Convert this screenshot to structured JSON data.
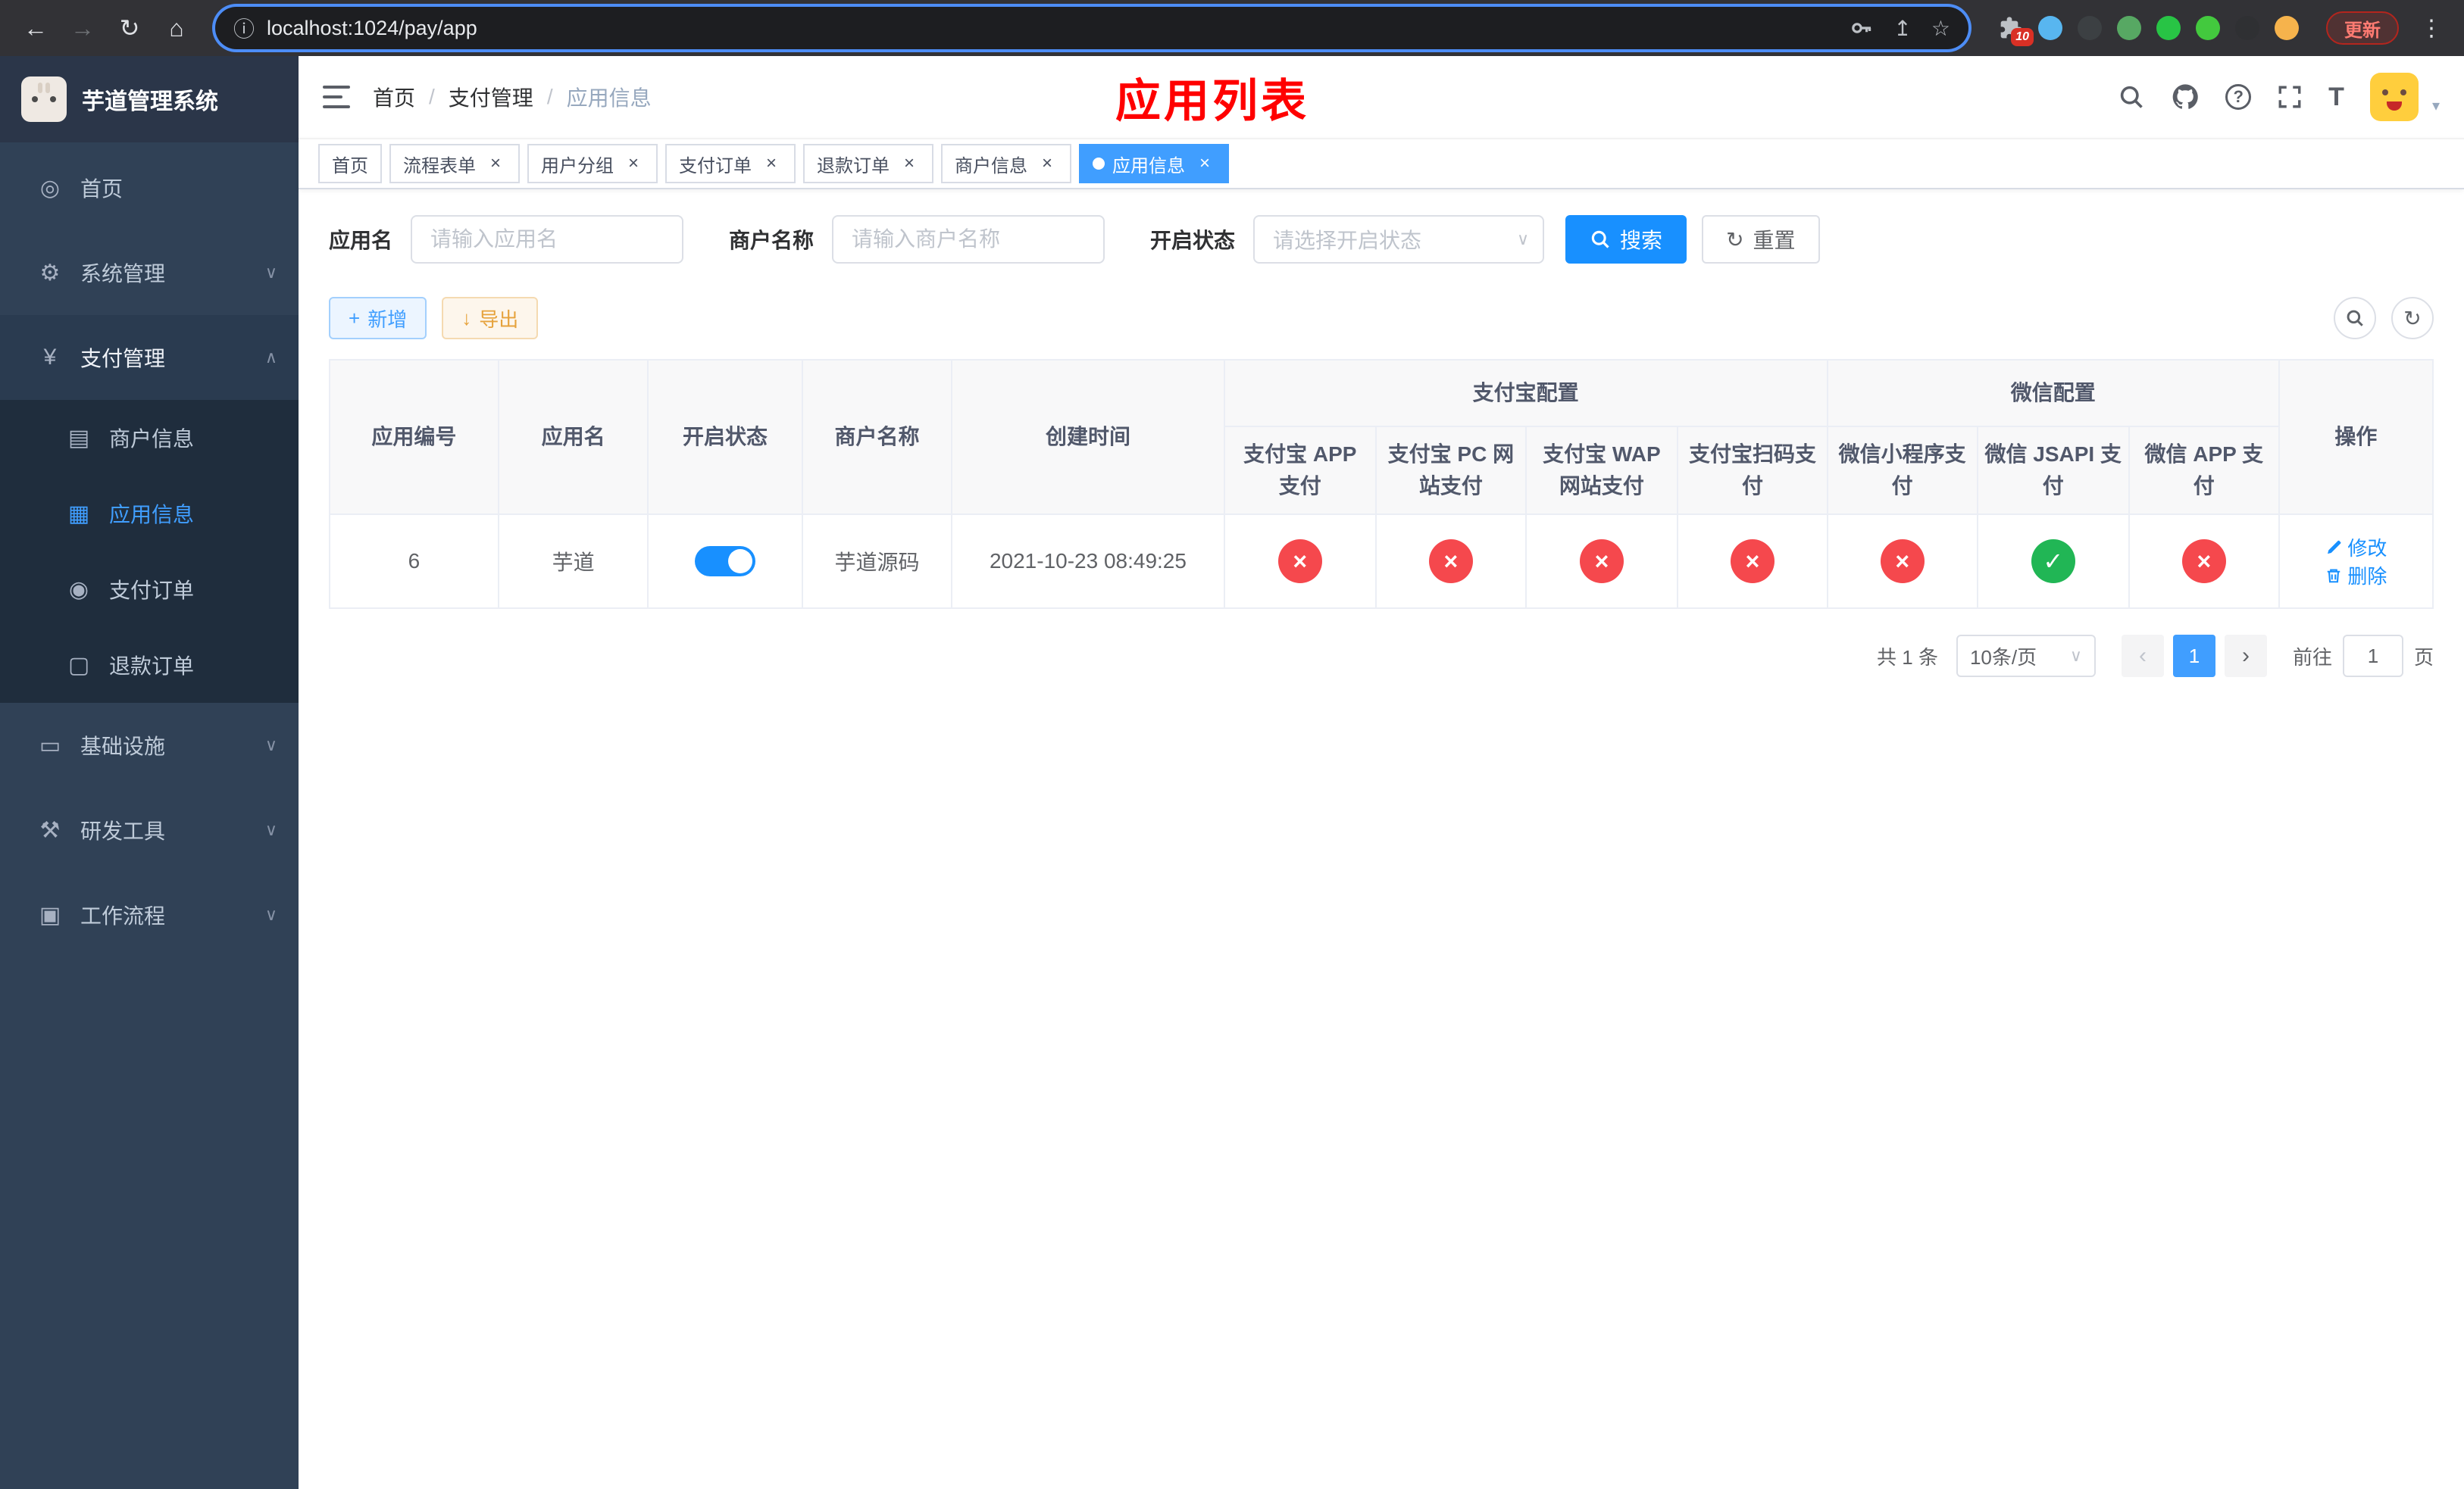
{
  "colors": {
    "accent": "#409eff",
    "primary": "#1890ff",
    "danger": "#f5484d",
    "success": "#21b655",
    "warning": "#e6a23c",
    "title-red": "#ff0000",
    "sidebar-bg": "#304156",
    "submenu-bg": "#1f2d3d",
    "logo-bg": "#2b3649",
    "chrome-bg": "#323236"
  },
  "icons": {
    "back": "←",
    "forward": "→",
    "reload": "↻",
    "home": "⌂",
    "info": "ⓘ",
    "share": "↥",
    "star": "☆",
    "kebab": "⋮",
    "question": "?",
    "fontsize": "T",
    "plus": "+",
    "download": "↓",
    "refresh": "↻",
    "caret-down": "▾",
    "chevron-down": "∨",
    "chevron-up": "∧",
    "select-arrow": "∨",
    "prev": "‹",
    "next": "›",
    "check": "✓",
    "cross": "×",
    "menu-home": "◎",
    "menu-system": "⚙",
    "menu-pay": "¥",
    "menu-merchant": "▤",
    "menu-app": "▦",
    "menu-order": "◉",
    "menu-refund": "▢",
    "menu-infra": "▭",
    "menu-devtool": "⚒",
    "menu-workflow": "▣"
  },
  "browser": {
    "url": "localhost:1024/pay/app",
    "update_label": "更新",
    "extensions_badge": "10",
    "extension_colors": [
      "#58b6f0",
      "#3c4043",
      "#57a863",
      "#28c445",
      "#43c93e",
      "#2f3033",
      "#f6b34c"
    ]
  },
  "sidebar": {
    "logo_title": "芋道管理系统",
    "items": [
      {
        "key": "home",
        "label": "首页",
        "icon": "menu-home"
      },
      {
        "key": "system",
        "label": "系统管理",
        "icon": "menu-system",
        "expandable": true
      },
      {
        "key": "payment",
        "label": "支付管理",
        "icon": "menu-pay",
        "expandable": true,
        "expanded": true,
        "children": [
          {
            "key": "merchant-info",
            "label": "商户信息",
            "icon": "menu-merchant"
          },
          {
            "key": "app-info",
            "label": "应用信息",
            "icon": "menu-app",
            "active": true
          },
          {
            "key": "pay-order",
            "label": "支付订单",
            "icon": "menu-order"
          },
          {
            "key": "refund-order",
            "label": "退款订单",
            "icon": "menu-refund"
          }
        ]
      },
      {
        "key": "infrastructure",
        "label": "基础设施",
        "icon": "menu-infra",
        "expandable": true
      },
      {
        "key": "dev-tools",
        "label": "研发工具",
        "icon": "menu-devtool",
        "expandable": true
      },
      {
        "key": "workflow",
        "label": "工作流程",
        "icon": "menu-workflow",
        "expandable": true
      }
    ]
  },
  "header": {
    "breadcrumb": [
      "首页",
      "支付管理",
      "应用信息"
    ],
    "separator": "/",
    "page_title": "应用列表"
  },
  "tabs": [
    {
      "key": "home",
      "label": "首页",
      "closable": false,
      "active": false
    },
    {
      "key": "process-form",
      "label": "流程表单",
      "closable": true,
      "active": false
    },
    {
      "key": "user-group",
      "label": "用户分组",
      "closable": true,
      "active": false
    },
    {
      "key": "pay-order",
      "label": "支付订单",
      "closable": true,
      "active": false
    },
    {
      "key": "refund-order",
      "label": "退款订单",
      "closable": true,
      "active": false
    },
    {
      "key": "merchant-info",
      "label": "商户信息",
      "closable": true,
      "active": false
    },
    {
      "key": "app-info",
      "label": "应用信息",
      "closable": true,
      "active": true
    }
  ],
  "filters": {
    "app_name_label": "应用名",
    "app_name_placeholder": "请输入应用名",
    "merchant_label": "商户名称",
    "merchant_placeholder": "请输入商户名称",
    "status_label": "开启状态",
    "status_placeholder": "请选择开启状态",
    "search_label": "搜索",
    "reset_label": "重置"
  },
  "toolbar": {
    "add_label": "新增",
    "export_label": "导出"
  },
  "table": {
    "main_columns": [
      "应用编号",
      "应用名",
      "开启状态",
      "商户名称",
      "创建时间",
      "操作"
    ],
    "alipay_group": "支付宝配置",
    "wechat_group": "微信配置",
    "alipay_columns": [
      "支付宝 APP 支付",
      "支付宝 PC 网站支付",
      "支付宝 WAP 网站支付",
      "支付宝扫码支付"
    ],
    "wechat_columns": [
      "微信小程序支付",
      "微信 JSAPI 支付",
      "微信 APP 支付"
    ],
    "rows": [
      {
        "id": "6",
        "name": "芋道",
        "enabled": true,
        "merchant": "芋道源码",
        "created_at": "2021-10-23 08:49:25",
        "alipay_status": [
          "closed",
          "closed",
          "closed",
          "closed"
        ],
        "wechat_status": [
          "closed",
          "open",
          "closed"
        ],
        "edit_label": "修改",
        "delete_label": "删除"
      }
    ]
  },
  "pagination": {
    "total_label": "共 1 条",
    "page_size_label": "10条/页",
    "current_page": "1",
    "goto_label": "前往",
    "goto_value": "1",
    "page_unit": "页"
  }
}
